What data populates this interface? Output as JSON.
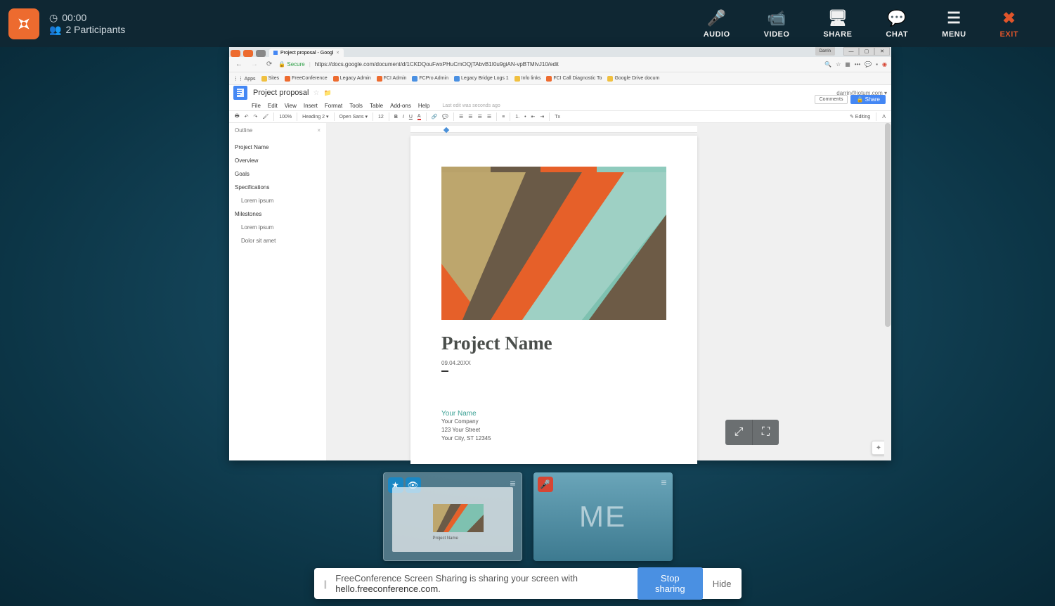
{
  "topbar": {
    "timer": "00:00",
    "participants_label": "2 Participants",
    "nav": {
      "audio": "AUDIO",
      "video": "VIDEO",
      "share": "SHARE",
      "chat": "CHAT",
      "menu": "MENU",
      "exit": "EXIT"
    }
  },
  "chrome": {
    "tab_title": "Project proposal - Googl",
    "window_user": "Darrin",
    "secure_label": "Secure",
    "url": "https://docs.google.com/document/d/1CKDQouFwxPHuCmOQjTAbvB1I0u9giAN-vpBTMIvJ10/edit",
    "bookmarks": {
      "apps": "Apps",
      "sites": "Sites",
      "fc": "FreeConference",
      "legacy": "Legacy Admin",
      "fci": "FCI Admin",
      "fcpro": "FCPro Admin",
      "lblogs": "Legacy Bridge Logs 1",
      "info": "Info links",
      "fcid": "FCI Call Diagnostic To",
      "gdrive": "Google Drive docum"
    }
  },
  "docs": {
    "title": "Project proposal",
    "user_email": "darrin@iotum.com ▾",
    "comments_btn": "Comments",
    "share_btn": "Share",
    "menu": {
      "file": "File",
      "edit": "Edit",
      "view": "View",
      "insert": "Insert",
      "format": "Format",
      "tools": "Tools",
      "table": "Table",
      "addons": "Add-ons",
      "help": "Help",
      "last_edit": "Last edit was seconds ago"
    },
    "toolbar": {
      "zoom": "100%",
      "style": "Heading 2 ▾",
      "font": "Open Sans ▾",
      "size": "12",
      "editing": "Editing"
    },
    "outline": {
      "label": "Outline",
      "items": [
        {
          "t": "Project Name",
          "sub": false
        },
        {
          "t": "Overview",
          "sub": false
        },
        {
          "t": "Goals",
          "sub": false
        },
        {
          "t": "Specifications",
          "sub": false
        },
        {
          "t": "Lorem ipsum",
          "sub": true
        },
        {
          "t": "Milestones",
          "sub": false
        },
        {
          "t": "Lorem ipsum",
          "sub": true
        },
        {
          "t": "Dolor sit amet",
          "sub": true
        }
      ]
    },
    "page": {
      "heading": "Project Name",
      "date": "09.04.20XX",
      "your_name": "Your Name",
      "company": "Your Company",
      "street": "123 Your Street",
      "city": "Your City, ST 12345"
    }
  },
  "thumb_preview_title": "Project Name",
  "me_label": "ME",
  "sharing": {
    "msg_pre": "FreeConference Screen Sharing is sharing your screen with ",
    "msg_domain": "hello.freeconference.com",
    "msg_post": ".",
    "stop": "Stop sharing",
    "hide": "Hide"
  }
}
